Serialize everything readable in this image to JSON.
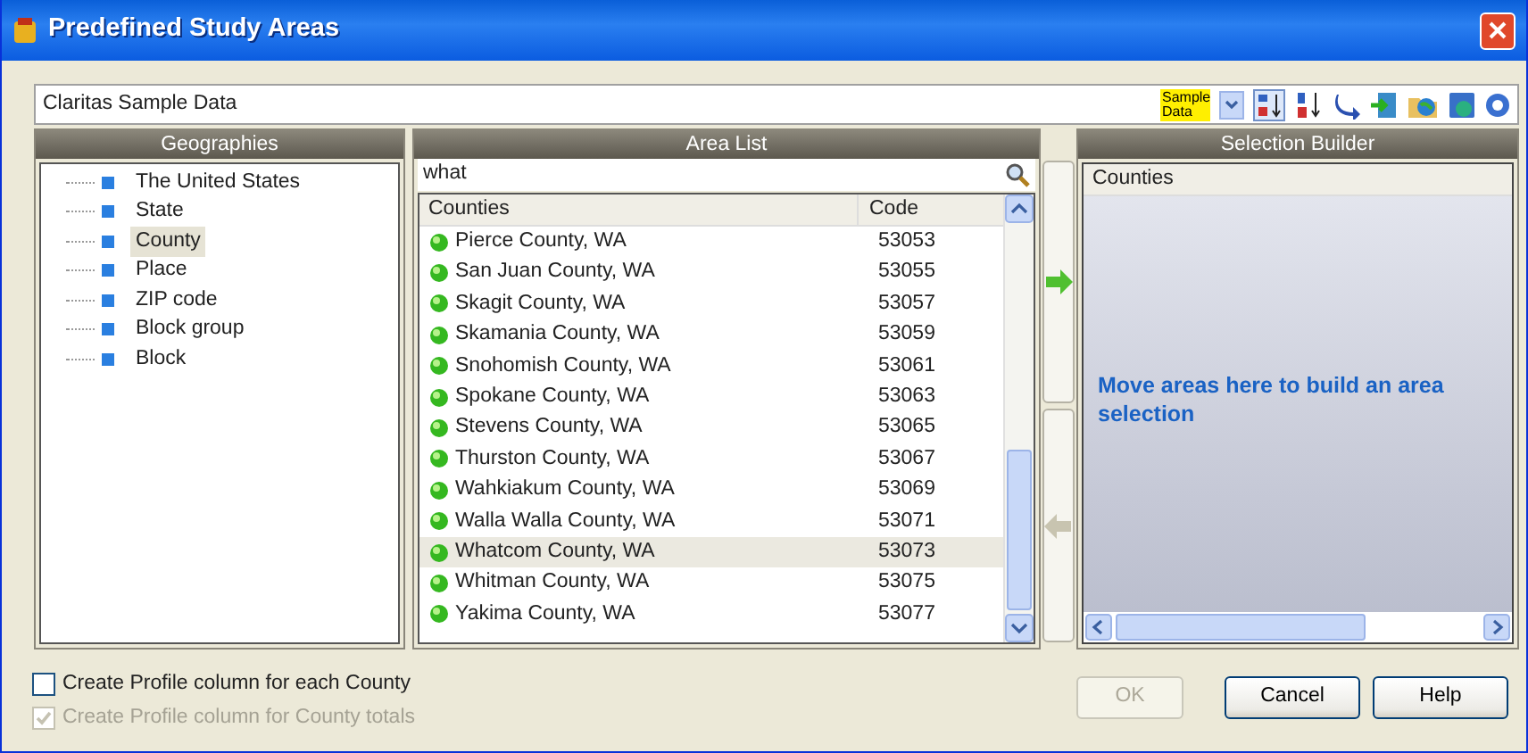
{
  "window": {
    "title": "Predefined Study Areas"
  },
  "data_source": {
    "value": "Claritas Sample Data",
    "badge": "Sample Data"
  },
  "geographies": {
    "title": "Geographies",
    "items": [
      {
        "label": "The United States",
        "selected": false
      },
      {
        "label": "State",
        "selected": false
      },
      {
        "label": "County",
        "selected": true
      },
      {
        "label": "Place",
        "selected": false
      },
      {
        "label": "ZIP code",
        "selected": false
      },
      {
        "label": "Block group",
        "selected": false
      },
      {
        "label": "Block",
        "selected": false
      }
    ]
  },
  "area_list": {
    "title": "Area List",
    "search": {
      "value": "what"
    },
    "columns": [
      "Counties",
      "Code"
    ],
    "rows": [
      {
        "name": "Pierce County, WA",
        "code": "53053",
        "selected": false
      },
      {
        "name": "San Juan County, WA",
        "code": "53055",
        "selected": false
      },
      {
        "name": "Skagit County, WA",
        "code": "53057",
        "selected": false
      },
      {
        "name": "Skamania County, WA",
        "code": "53059",
        "selected": false
      },
      {
        "name": "Snohomish County, WA",
        "code": "53061",
        "selected": false
      },
      {
        "name": "Spokane County, WA",
        "code": "53063",
        "selected": false
      },
      {
        "name": "Stevens County, WA",
        "code": "53065",
        "selected": false
      },
      {
        "name": "Thurston County, WA",
        "code": "53067",
        "selected": false
      },
      {
        "name": "Wahkiakum County, WA",
        "code": "53069",
        "selected": false
      },
      {
        "name": "Walla Walla County, WA",
        "code": "53071",
        "selected": false
      },
      {
        "name": "Whatcom County, WA",
        "code": "53073",
        "selected": true
      },
      {
        "name": "Whitman County, WA",
        "code": "53075",
        "selected": false
      },
      {
        "name": "Yakima County, WA",
        "code": "53077",
        "selected": false
      }
    ]
  },
  "selection_builder": {
    "title": "Selection Builder",
    "column": "Counties",
    "hint": "Move areas here to build an area selection"
  },
  "options": [
    {
      "label": "Create Profile column for each County",
      "checked": false,
      "disabled": false
    },
    {
      "label": "Create Profile column for County totals",
      "checked": true,
      "disabled": true
    }
  ],
  "buttons": [
    {
      "label": "OK",
      "disabled": true
    },
    {
      "label": "Cancel",
      "disabled": false
    },
    {
      "label": "Help",
      "disabled": false
    }
  ]
}
